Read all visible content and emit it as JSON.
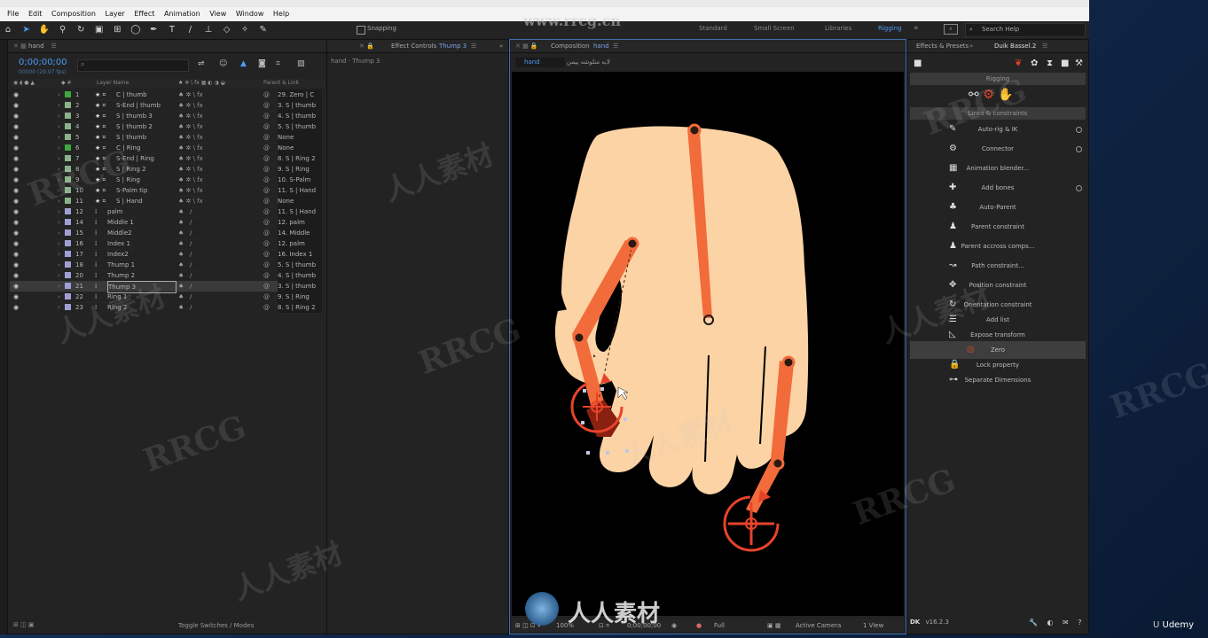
{
  "menu": [
    "File",
    "Edit",
    "Composition",
    "Layer",
    "Effect",
    "Animation",
    "View",
    "Window",
    "Help"
  ],
  "toolbar": {
    "snapping": "Snapping"
  },
  "workspaces": [
    "Standard",
    "Small Screen",
    "Libraries",
    "Rigging"
  ],
  "active_workspace": "Rigging",
  "search_help": "Search Help",
  "project": {
    "tab": "hand",
    "timecode": "0;00;00;00",
    "fps": "00000 (29.97 fps)",
    "col_layer_name": "Layer Name",
    "col_parent": "Parent & Link",
    "toggle_label": "Toggle Switches / Modes",
    "layers": [
      {
        "num": "1",
        "name": "C | thumb",
        "parent": "29. Zero | C",
        "color": "#3fa83f",
        "star": true
      },
      {
        "num": "2",
        "name": "S-End | thumb",
        "parent": "3. S | thumb",
        "color": "#8ab38a",
        "star": true
      },
      {
        "num": "3",
        "name": "S | thumb 3",
        "parent": "4. S | thumb",
        "color": "#8ab38a",
        "star": true
      },
      {
        "num": "4",
        "name": "S | thumb 2",
        "parent": "5. S | thumb",
        "color": "#8ab38a",
        "star": true
      },
      {
        "num": "5",
        "name": "S | thumb",
        "parent": "None",
        "color": "#8ab38a",
        "star": true
      },
      {
        "num": "6",
        "name": "C | Ring",
        "parent": "None",
        "color": "#3fa83f",
        "star": true
      },
      {
        "num": "7",
        "name": "S-End | Ring",
        "parent": "8. S | Ring 2",
        "color": "#8ab38a",
        "star": true
      },
      {
        "num": "8",
        "name": "S | Ring 2",
        "parent": "9. S | Ring",
        "color": "#8ab38a",
        "star": true
      },
      {
        "num": "9",
        "name": "S | Ring",
        "parent": "10. S-Palm",
        "color": "#8ab38a",
        "star": true
      },
      {
        "num": "10",
        "name": "S-Palm tip",
        "parent": "11. S | Hand",
        "color": "#8ab38a",
        "star": true
      },
      {
        "num": "11",
        "name": "S | Hand",
        "parent": "None",
        "color": "#8ab38a",
        "star": true
      },
      {
        "num": "12",
        "name": "palm",
        "parent": "11. S | Hand",
        "color": "#9f9fd6",
        "star": false
      },
      {
        "num": "14",
        "name": "Middle 1",
        "parent": "12. palm",
        "color": "#9f9fd6",
        "star": false
      },
      {
        "num": "15",
        "name": "Middle2",
        "parent": "14. Middle",
        "color": "#9f9fd6",
        "star": false
      },
      {
        "num": "16",
        "name": "Index 1",
        "parent": "12. palm",
        "color": "#9f9fd6",
        "star": false
      },
      {
        "num": "17",
        "name": "Index2",
        "parent": "16. Index 1",
        "color": "#9f9fd6",
        "star": false
      },
      {
        "num": "18",
        "name": "Thump 1",
        "parent": "5. S | thumb",
        "color": "#9f9fd6",
        "star": false
      },
      {
        "num": "20",
        "name": "Thump 2",
        "parent": "4. S | thumb",
        "color": "#9f9fd6",
        "star": false
      },
      {
        "num": "21",
        "name": "Thump 3",
        "parent": "3. S | thumb",
        "color": "#9f9fd6",
        "star": false,
        "selected": true
      },
      {
        "num": "22",
        "name": "Ring 1",
        "parent": "9. S | Ring",
        "color": "#9f9fd6",
        "star": false
      },
      {
        "num": "23",
        "name": "Ring 2",
        "parent": "8. S | Ring 2",
        "color": "#9f9fd6",
        "star": false
      }
    ]
  },
  "effect_controls": {
    "tab": "Effect Controls",
    "target": "Thump 3",
    "path": "hand · Thump 3"
  },
  "composition": {
    "tab": "Composition",
    "name": "hand",
    "breadcrumb": "hand",
    "flow_text": "لایه متلوشه پیمن",
    "zoom": "100%",
    "timecode": "0;00;00;00",
    "resolution": "Full",
    "camera": "Active Camera",
    "views": "1 View"
  },
  "right_panel": {
    "tab_effects": "Effects & Presets",
    "tab_duik": "Duik Bassel.2",
    "section_rigging": "Rigging",
    "section_links": "Links & constraints",
    "items": [
      {
        "label": "Auto-rig & IK",
        "icon": "✎",
        "dot": true
      },
      {
        "label": "Connector",
        "icon": "⚙",
        "dot": true
      },
      {
        "label": "Animation blender...",
        "icon": "▦",
        "dot": false
      },
      {
        "label": "Add bones",
        "icon": "✚",
        "dot": true
      },
      {
        "label": "Auto-Parent",
        "icon": "♣",
        "dot": false
      },
      {
        "label": "Parent constraint",
        "icon": "♟",
        "dot": false
      },
      {
        "label": "Parent accross comps...",
        "icon": "♟",
        "dot": false
      },
      {
        "label": "Path constraint...",
        "icon": "↝",
        "dot": false
      },
      {
        "label": "Position constraint",
        "icon": "✥",
        "dot": false
      },
      {
        "label": "Orientation constraint",
        "icon": "↻",
        "dot": false
      },
      {
        "label": "Add list",
        "icon": "☰",
        "dot": false
      },
      {
        "label": "Expose transform",
        "icon": "◺",
        "dot": false
      },
      {
        "label": "Zero",
        "icon": "◎",
        "dot": false,
        "highlight": true
      },
      {
        "label": "Lock property",
        "icon": "🔒",
        "dot": false
      },
      {
        "label": "Separate Dimensions",
        "icon": "⊶",
        "dot": false
      }
    ],
    "version": "v16.2.3"
  },
  "watermarks": {
    "brand": "RRCG",
    "site": "www.rrcg.cn",
    "cn": "人人素材",
    "udemy": "Udemy"
  },
  "colors": {
    "accent": "#2d8cf0",
    "skin": "#fcd3a5",
    "bone": "#f26b3a",
    "controller": "#e8432a"
  }
}
